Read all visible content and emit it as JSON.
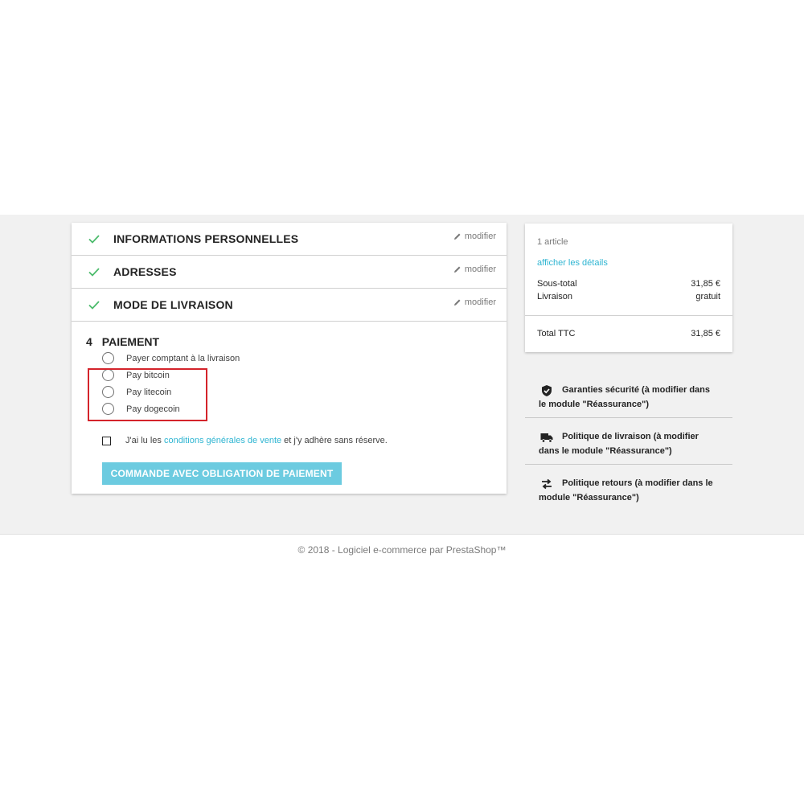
{
  "checkout": {
    "steps": [
      {
        "title": "INFORMATIONS PERSONNELLES",
        "edit_label": "modifier"
      },
      {
        "title": "ADRESSES",
        "edit_label": "modifier"
      },
      {
        "title": "MODE DE LIVRAISON",
        "edit_label": "modifier"
      }
    ],
    "payment": {
      "number": "4",
      "title": "PAIEMENT",
      "options": [
        {
          "label": "Payer comptant à la livraison"
        },
        {
          "label": "Pay bitcoin"
        },
        {
          "label": "Pay litecoin"
        },
        {
          "label": "Pay dogecoin"
        }
      ],
      "terms_prefix": "J'ai lu les ",
      "terms_link": "conditions générales de vente",
      "terms_suffix": " et j'y adhère sans réserve.",
      "order_button": "COMMANDE AVEC OBLIGATION DE PAIEMENT"
    }
  },
  "summary": {
    "count": "1 article",
    "details_link": "afficher les détails",
    "subtotal_label": "Sous-total",
    "subtotal_value": "31,85 €",
    "shipping_label": "Livraison",
    "shipping_value": "gratuit",
    "total_label": "Total TTC",
    "total_value": "31,85 €"
  },
  "reassurance": [
    {
      "icon": "shield-icon",
      "text": "Garanties sécurité (à modifier dans le module \"Réassurance\")"
    },
    {
      "icon": "truck-icon",
      "text": "Politique de livraison (à modifier dans le module \"Réassurance\")"
    },
    {
      "icon": "exchange-arrows-icon",
      "text": "Politique retours (à modifier dans le module \"Réassurance\")"
    }
  ],
  "footer": "© 2018 - Logiciel e-commerce par PrestaShop™",
  "colors": {
    "accent": "#2fb5d2",
    "button": "#6ccbe0",
    "check": "#4cbb6c",
    "highlight": "#d4242b",
    "band": "#f1f1f1"
  }
}
